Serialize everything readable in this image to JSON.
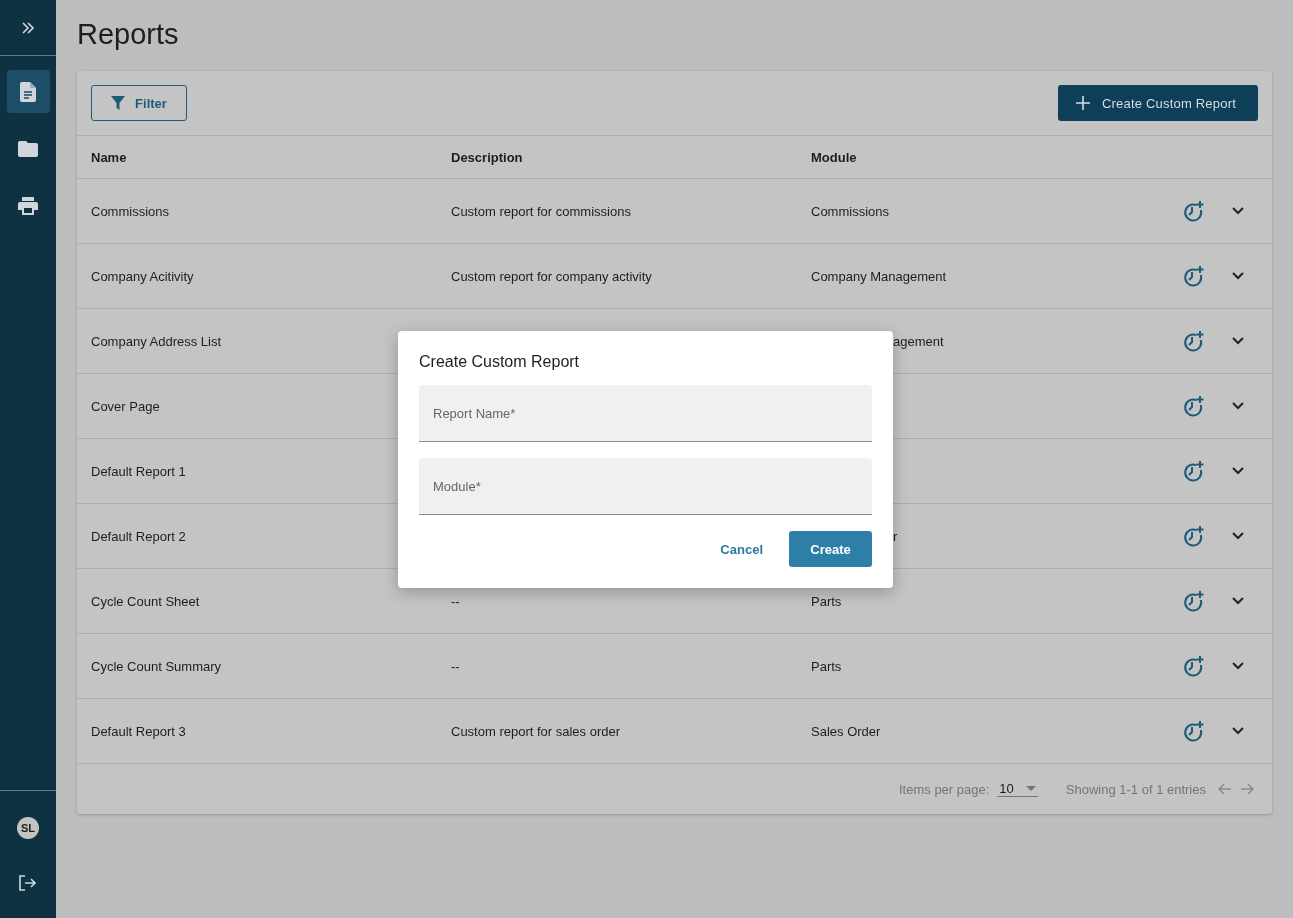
{
  "sidebar": {
    "nav_items": [
      {
        "kind": "document",
        "selected": true
      },
      {
        "kind": "folder",
        "selected": false
      },
      {
        "kind": "printer",
        "selected": false
      }
    ],
    "avatar": "SL"
  },
  "page_title": "Reports",
  "toolbar": {
    "filter_button": "Filter",
    "create_button": "Create Custom Report"
  },
  "table": {
    "columns": [
      "Name",
      "Description",
      "Module"
    ],
    "rows": [
      {
        "cells": [
          {
            "text": "Commissions"
          },
          {
            "text": "Custom report for commissions"
          },
          {
            "text": "Commissions"
          }
        ]
      },
      {
        "cells": [
          {
            "text": "Company Acitivity"
          },
          {
            "text": "Custom report for company activity"
          },
          {
            "text": "Company Management"
          }
        ]
      },
      {
        "cells": [
          {
            "text": "Company Address List"
          },
          {},
          {
            "text": "agement",
            "covered": true
          }
        ]
      },
      {
        "cells": [
          {
            "text": "Cover Page"
          },
          {},
          {}
        ]
      },
      {
        "cells": [
          {
            "text": "Default Report 1"
          },
          {},
          {}
        ]
      },
      {
        "cells": [
          {
            "text": "Default Report 2"
          },
          {},
          {
            "text": "r",
            "covered": true
          }
        ]
      },
      {
        "cells": [
          {
            "text": "Cycle Count Sheet"
          },
          {
            "text": "--"
          },
          {
            "text": "Parts"
          }
        ]
      },
      {
        "cells": [
          {
            "text": "Cycle Count Summary"
          },
          {
            "text": "--"
          },
          {
            "text": "Parts"
          }
        ]
      },
      {
        "cells": [
          {
            "text": "Default Report 3"
          },
          {
            "text": "Custom report for sales order"
          },
          {
            "text": "Sales Order"
          }
        ]
      }
    ]
  },
  "pagination": {
    "items_label": "Items per page:",
    "page_size": "10",
    "showing": "Showing 1-1 of 1 entries"
  },
  "dialog": {
    "title": "Create Custom Report",
    "fields": [
      {
        "placeholder": "Report Name*"
      },
      {
        "placeholder": "Module*"
      }
    ],
    "cancel": "Cancel",
    "create": "Create"
  }
}
